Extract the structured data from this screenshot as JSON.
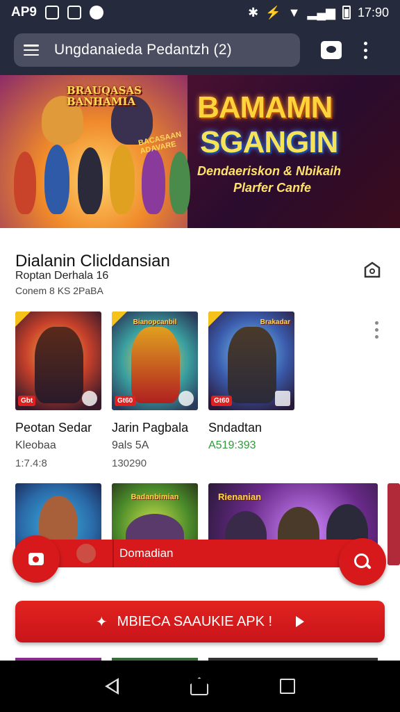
{
  "status_bar": {
    "left_text": "AP9",
    "time": "17:90"
  },
  "app_bar": {
    "title": "Ungdanaieda Pedantzh (2)"
  },
  "banner": {
    "title_line1": "BAMAMN",
    "title_line2": "SGANGIN",
    "subtitle_line1": "Dendaeriskon & Nbikaih",
    "subtitle_line2": "Plarfer Canfe",
    "left_logo": "BRAUQASAS BANHAMIA",
    "left_small": "BACASAAN ADAVARE"
  },
  "section": {
    "title": "Dialanin Clicldansian",
    "subtitle": "Roptan Derhala 16",
    "meta": "Conem 8 KS 2PaBA"
  },
  "apps": [
    {
      "name": "Peotan Sedar",
      "dev": "Kleobaa",
      "meta": "1:7.4:8",
      "tag": "Gbt"
    },
    {
      "name": "Jarin Pagbala",
      "dev": "9als 5A",
      "meta": "130290",
      "tag": "Gt60",
      "card_title": "Bianopcanbil"
    },
    {
      "name": "Sndadtan",
      "dev": "A519:393",
      "meta": "",
      "tag": "Gt60",
      "card_title": "Brakadar"
    }
  ],
  "row2_titles": [
    "",
    "Badanbimian",
    "Rienanian"
  ],
  "action_bar": {
    "label": "Domadian"
  },
  "download_button": {
    "label": "MBIECA SAAUKIE APK !"
  },
  "icons": {
    "menu": "hamburger-icon",
    "chat": "chat-icon",
    "more": "more-vert-icon",
    "share": "share-icon",
    "camera": "camera-icon",
    "search": "search-icon"
  },
  "colors": {
    "accent": "#d7191c",
    "app_bar": "#262a3d",
    "green": "#2e9a3a"
  }
}
